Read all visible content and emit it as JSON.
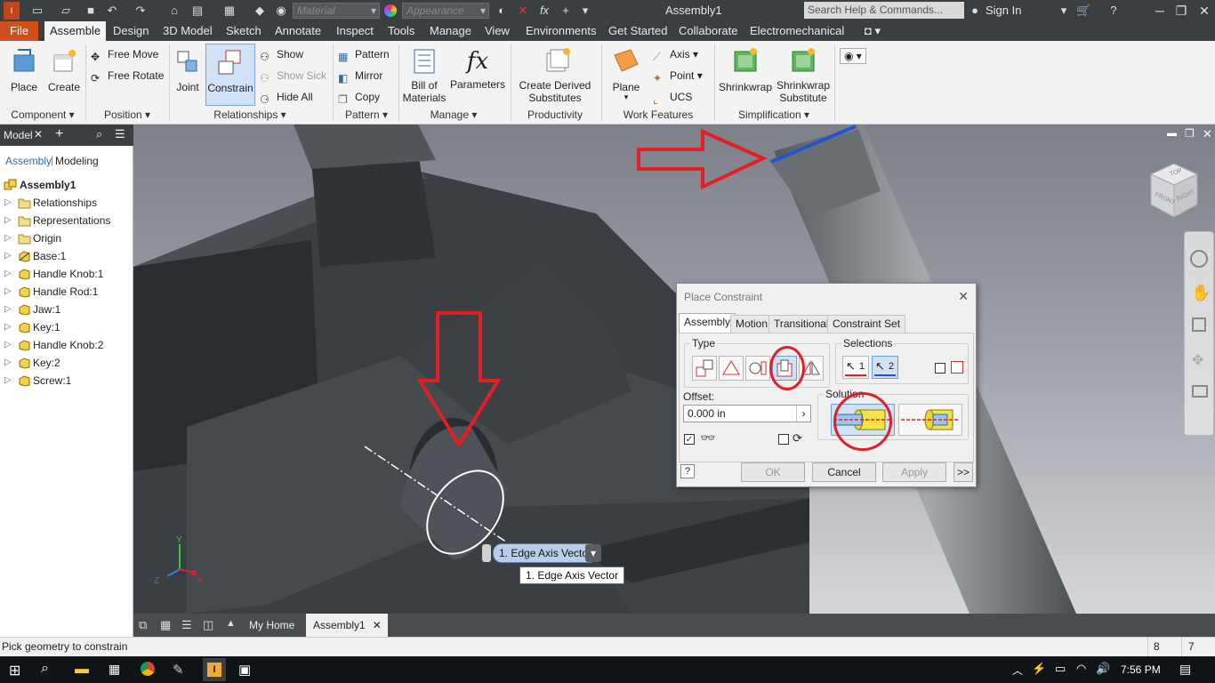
{
  "titlebar": {
    "title": "Assembly1",
    "material_placeholder": "Material",
    "appearance_placeholder": "Appearance",
    "search_placeholder": "Search Help & Commands...",
    "sign_in": "Sign In"
  },
  "ribbon_tabs": [
    "File",
    "Assemble",
    "Design",
    "3D Model",
    "Sketch",
    "Annotate",
    "Inspect",
    "Tools",
    "Manage",
    "View",
    "Environments",
    "Get Started",
    "Collaborate",
    "Electromechanical"
  ],
  "active_tab": "Assemble",
  "ribbon": {
    "place": "Place",
    "create": "Create",
    "free_move": "Free Move",
    "free_rotate": "Free Rotate",
    "joint": "Joint",
    "constrain": "Constrain",
    "show": "Show",
    "show_sick": "Show Sick",
    "hide_all": "Hide All",
    "pattern": "Pattern",
    "mirror": "Mirror",
    "copy": "Copy",
    "bill_of_materials_1": "Bill of",
    "bill_of_materials_2": "Materials",
    "parameters": "Parameters",
    "create_derived_1": "Create Derived",
    "create_derived_2": "Substitutes",
    "plane": "Plane",
    "axis": "Axis",
    "point": "Point",
    "ucs": "UCS",
    "shrinkwrap": "Shrinkwrap",
    "shrinkwrap_sub_1": "Shrinkwrap",
    "shrinkwrap_sub_2": "Substitute",
    "groups": {
      "component": "Component",
      "position": "Position",
      "relationships": "Relationships",
      "pattern": "Pattern",
      "manage": "Manage",
      "productivity": "Productivity",
      "work_features": "Work Features",
      "simplification": "Simplification"
    }
  },
  "browser": {
    "header_tab": "Model",
    "modes": [
      "Assembly",
      "Modeling"
    ],
    "root": "Assembly1",
    "items": [
      "Relationships",
      "Representations",
      "Origin",
      "Base:1",
      "Handle Knob:1",
      "Handle Rod:1",
      "Jaw:1",
      "Key:1",
      "Handle Knob:2",
      "Key:2",
      "Screw:1"
    ]
  },
  "viewport": {
    "selection_tag": "1. Edge Axis Vector",
    "tooltip": "1. Edge Axis Vector",
    "axis_labels": {
      "y": "Y",
      "x": "X",
      "z": "Z"
    },
    "viewcube_faces": [
      "TOP",
      "FRONT",
      "RIGHT"
    ]
  },
  "dialog": {
    "title": "Place Constraint",
    "tabs": [
      "Assembly",
      "Motion",
      "Transitional",
      "Constraint Set"
    ],
    "active_tab": "Assembly",
    "type_label": "Type",
    "selections_label": "Selections",
    "selection_1": "1",
    "selection_2": "2",
    "offset_label": "Offset:",
    "offset_value": "0.000 in",
    "solution_label": "Solution",
    "ok": "OK",
    "cancel": "Cancel",
    "apply": "Apply",
    "more": ">>"
  },
  "doc_tabs": [
    "My Home",
    "Assembly1"
  ],
  "active_doc": "Assembly1",
  "status": {
    "message": "Pick geometry to constrain",
    "count_a": "8",
    "count_b": "7"
  },
  "taskbar": {
    "time": "7:56 PM"
  },
  "colors": {
    "file_tab": "#d34f1a",
    "annotation_red": "#e41e25",
    "selection_blue": "#2255cc"
  }
}
